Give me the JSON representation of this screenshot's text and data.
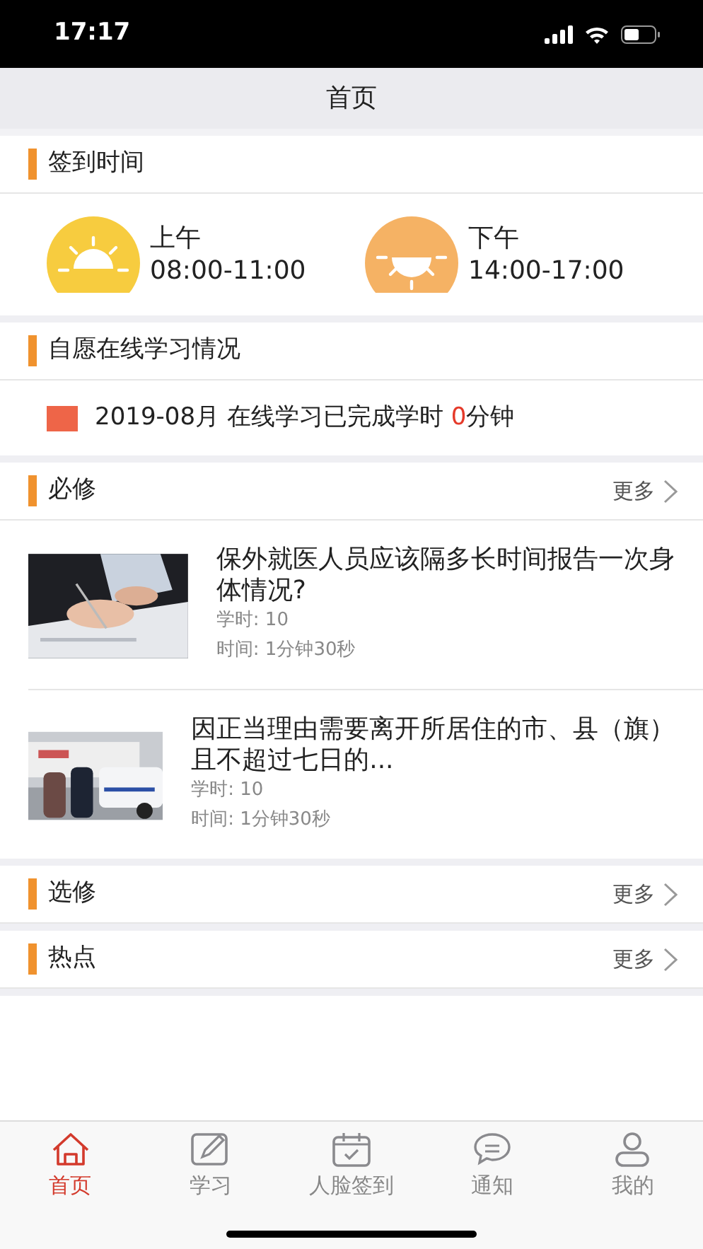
{
  "status_bar": {
    "time": "17:17"
  },
  "title": "首页",
  "checkin": {
    "title": "签到时间",
    "slots": [
      {
        "label": "上午",
        "time": "08:00-11:00",
        "color": "#f7cc3f"
      },
      {
        "label": "下午",
        "time": "14:00-17:00",
        "color": "#f5b264"
      }
    ]
  },
  "online_study": {
    "title": "自愿在线学习情况",
    "text": "2019-08月 在线学习已完成学时",
    "minutes": "0",
    "unit": "分钟"
  },
  "required": {
    "title": "必修",
    "more": "更多",
    "courses": [
      {
        "title": "保外就医人员应该隔多长时间报告一次身体情况?",
        "hours": "学时: 10",
        "duration": "时间: 1分钟30秒"
      },
      {
        "title": "因正当理由需要离开所居住的市、县（旗）且不超过七日的...",
        "hours": "学时: 10",
        "duration": "时间: 1分钟30秒"
      }
    ]
  },
  "elective": {
    "title": "选修",
    "more": "更多"
  },
  "hot": {
    "title": "热点",
    "more": "更多"
  },
  "tabs": [
    {
      "label": "首页",
      "selected": true
    },
    {
      "label": "学习",
      "selected": false
    },
    {
      "label": "人脸签到",
      "selected": false
    },
    {
      "label": "通知",
      "selected": false
    },
    {
      "label": "我的",
      "selected": false
    }
  ]
}
